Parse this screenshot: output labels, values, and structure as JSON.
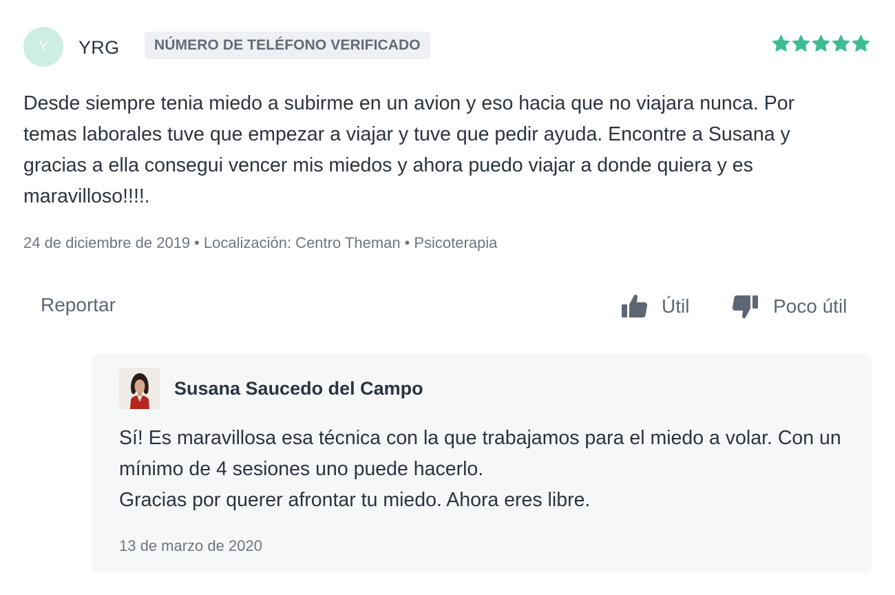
{
  "review": {
    "avatar_initial": "Y",
    "author": "YRG",
    "badge": "NÚMERO DE TELÉFONO VERIFICADO",
    "rating": 5,
    "star_color": "#3dbd93",
    "text": "Desde siempre tenia miedo a subirme en un avion y eso hacia que no viajara nunca. Por temas laborales tuve que empezar a viajar y tuve que pedir ayuda. Encontre a Susana y gracias a ella consegui vencer mis miedos y ahora puedo viajar a donde quiera y es maravilloso!!!!.",
    "meta": {
      "date": "24 de diciembre de 2019",
      "separator": "•",
      "location": "Localización: Centro Theman",
      "service": "Psicoterapia"
    }
  },
  "actions": {
    "report": "Reportar",
    "helpful": "Útil",
    "not_helpful": "Poco útil",
    "icons": {
      "helpful": "thumbs-up-icon",
      "not_helpful": "thumbs-down-icon"
    }
  },
  "reply": {
    "author": "Susana Saucedo del Campo",
    "photo": "doctor-avatar",
    "lines": [
      "Sí! Es maravillosa esa técnica con la que trabajamos para el miedo a volar. Con un mínimo de 4 sesiones uno puede hacerlo.",
      "Gracias por querer afrontar tu miedo. Ahora eres libre."
    ],
    "date": "13 de marzo de 2020"
  }
}
